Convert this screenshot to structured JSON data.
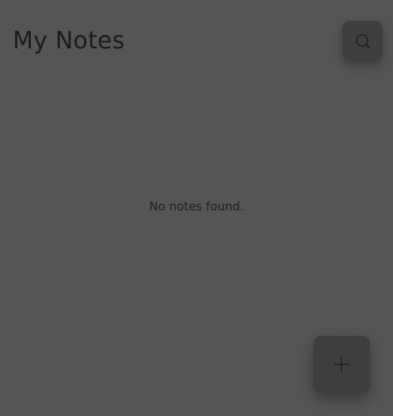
{
  "header": {
    "title": "My Notes",
    "search_icon": "search-icon"
  },
  "main": {
    "empty_message": "No notes found."
  },
  "fab": {
    "icon": "plus-icon"
  },
  "colors": {
    "background": "#555553",
    "button_bg": "#3f3f3f",
    "text": "#1c1c1c"
  }
}
